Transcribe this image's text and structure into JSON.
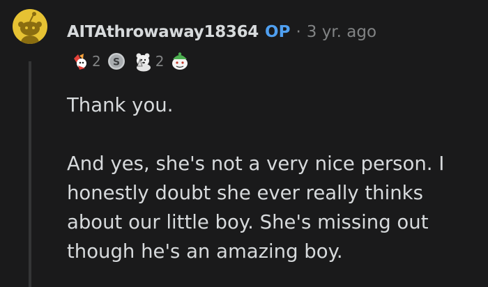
{
  "comment": {
    "username": "AITAthrowaway18364",
    "op_flair": "OP",
    "separator": "·",
    "timestamp": "3 yr. ago",
    "awards": [
      {
        "icon": "wholesome-seal-icon",
        "count": "2"
      },
      {
        "icon": "silver-coin-icon",
        "count": ""
      },
      {
        "icon": "bless-up-bear-icon",
        "count": "2"
      },
      {
        "icon": "helpful-snoo-icon",
        "count": ""
      }
    ],
    "paragraphs": [
      "Thank you.",
      "And yes, she's not a very nice person. I honestly doubt she ever really thinks about our little boy. She's missing out though he's an amazing boy."
    ]
  },
  "colors": {
    "background": "#1a1a1b",
    "text": "#d7dadc",
    "muted": "#818384",
    "op": "#4f9ff0",
    "avatar": "#e6c233"
  }
}
